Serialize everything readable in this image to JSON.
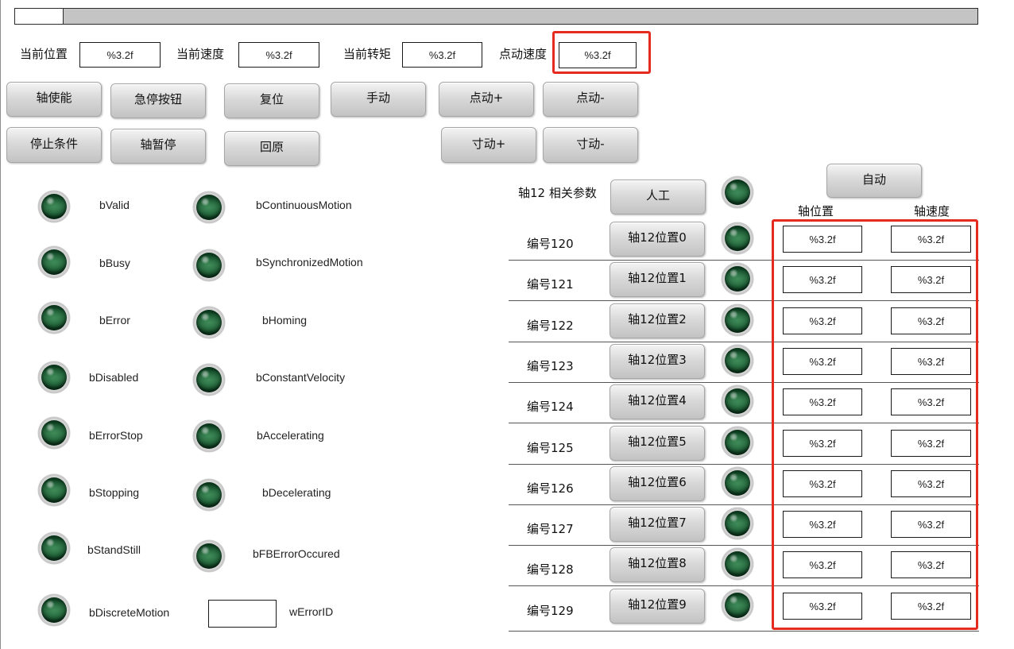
{
  "colors": {
    "annotation_highlight": "#e52b1f",
    "lamp_off": "#0f4424",
    "button_face": "#d9d9d9",
    "bar_track": "#c4c4c4",
    "bar_fill": "#ffffff"
  },
  "position_bar": {
    "fill_fraction": 0.05
  },
  "readouts": [
    {
      "label": "当前位置",
      "value": "%3.2f"
    },
    {
      "label": "当前速度",
      "value": "%3.2f"
    },
    {
      "label": "当前转矩",
      "value": "%3.2f"
    },
    {
      "label": "点动速度",
      "value": "%3.2f"
    }
  ],
  "buttons": {
    "axis_enable": "轴使能",
    "emergency_stop": "急停按钮",
    "reset": "复位",
    "manual": "手动",
    "jog_plus": "点动+",
    "jog_minus": "点动-",
    "stop_condition": "停止条件",
    "axis_pause": "轴暂停",
    "homing": "回原",
    "inch_plus": "寸动+",
    "inch_minus": "寸动-"
  },
  "status_flags": [
    {
      "name": "bValid",
      "lit": false
    },
    {
      "name": "bBusy",
      "lit": false
    },
    {
      "name": "bError",
      "lit": false
    },
    {
      "name": "bDisabled",
      "lit": false
    },
    {
      "name": "bErrorStop",
      "lit": false
    },
    {
      "name": "bStopping",
      "lit": false
    },
    {
      "name": "bStandStill",
      "lit": false
    },
    {
      "name": "bDiscreteMotion",
      "lit": false
    },
    {
      "name": "bContinuousMotion",
      "lit": false
    },
    {
      "name": "bSynchronizedMotion",
      "lit": false
    },
    {
      "name": "bHoming",
      "lit": false
    },
    {
      "name": "bConstantVelocity",
      "lit": false
    },
    {
      "name": "bAccelerating",
      "lit": false
    },
    {
      "name": "bDecelerating",
      "lit": false
    },
    {
      "name": "bFBErrorOccured",
      "lit": false
    }
  ],
  "error_id": {
    "label": "wErrorID",
    "value": ""
  },
  "axis12": {
    "title": "轴12 相关参数",
    "manual_button": "人工",
    "auto_button": "自动",
    "mode_lamp_lit": false,
    "columns": {
      "position": "轴位置",
      "velocity": "轴速度"
    },
    "rows": [
      {
        "id": "编号120",
        "button": "轴12位置0",
        "lamp_lit": false,
        "position": "%3.2f",
        "velocity": "%3.2f"
      },
      {
        "id": "编号121",
        "button": "轴12位置1",
        "lamp_lit": false,
        "position": "%3.2f",
        "velocity": "%3.2f"
      },
      {
        "id": "编号122",
        "button": "轴12位置2",
        "lamp_lit": false,
        "position": "%3.2f",
        "velocity": "%3.2f"
      },
      {
        "id": "编号123",
        "button": "轴12位置3",
        "lamp_lit": false,
        "position": "%3.2f",
        "velocity": "%3.2f"
      },
      {
        "id": "编号124",
        "button": "轴12位置4",
        "lamp_lit": false,
        "position": "%3.2f",
        "velocity": "%3.2f"
      },
      {
        "id": "编号125",
        "button": "轴12位置5",
        "lamp_lit": false,
        "position": "%3.2f",
        "velocity": "%3.2f"
      },
      {
        "id": "编号126",
        "button": "轴12位置6",
        "lamp_lit": false,
        "position": "%3.2f",
        "velocity": "%3.2f"
      },
      {
        "id": "编号127",
        "button": "轴12位置7",
        "lamp_lit": false,
        "position": "%3.2f",
        "velocity": "%3.2f"
      },
      {
        "id": "编号128",
        "button": "轴12位置8",
        "lamp_lit": false,
        "position": "%3.2f",
        "velocity": "%3.2f"
      },
      {
        "id": "编号129",
        "button": "轴12位置9",
        "lamp_lit": false,
        "position": "%3.2f",
        "velocity": "%3.2f"
      }
    ]
  }
}
